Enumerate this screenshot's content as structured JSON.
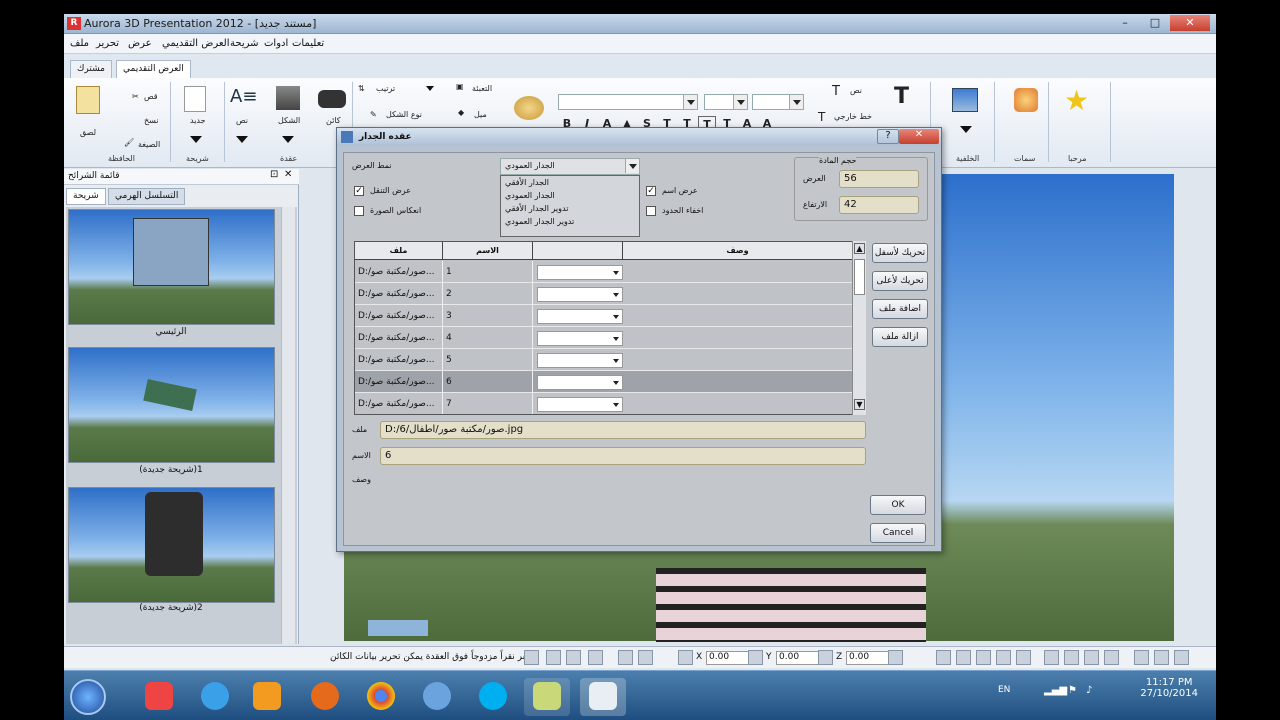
{
  "window": {
    "title": "Aurora 3D Presentation 2012 - [مستند جديد]",
    "min": "–",
    "max": "□",
    "close": "✕"
  },
  "menu": [
    "ملف",
    "تحرير",
    "عرض",
    "العرض التقديمي",
    "شريحة",
    "ادوات",
    "تعليمات"
  ],
  "ribbon_tabs": {
    "share": "مشترك",
    "presentation": "العرض التقديمي"
  },
  "ribbon": {
    "paste": "لصق",
    "cut": "قص",
    "copy": "نسخ",
    "format_painter": "الصيغة",
    "clipboard_group": "الحافظة",
    "new": "جديد",
    "slide_group": "شريحة",
    "text": "نص",
    "shape": "الشكل",
    "object": "كائن",
    "node_group": "عقدة",
    "arrange": "ترتيب",
    "shape_type": "نوع الشكل",
    "fill": "التعبئة",
    "tilt": "ميل",
    "text_btn": "نص",
    "outline_text": "خط خارجي",
    "background": "الخلفية",
    "themes": "سمات",
    "welcome": "مرحبا",
    "format_buttons": [
      "B",
      "I",
      "A",
      "S",
      "T",
      "T",
      "T",
      "T",
      "A",
      "A"
    ]
  },
  "left_panel": {
    "title": "قائمة الشرائح",
    "tab_slide": "شريحة",
    "tab_hierarchy": "التسلسل الهرمي",
    "thumbs": [
      "الرئيسي",
      "(شريحة جديدة)1",
      "(شريحة جديدة)2"
    ]
  },
  "dialog": {
    "title": "عقده الجدار",
    "help": "?",
    "close": "✕",
    "display_mode_label": "نمط العرض",
    "display_mode_value": "الجدار العمودي",
    "dropdown_options": [
      "الجدار الأفقي",
      "الجدار العمودي",
      "تدوير الجدار الأفقي",
      "تدوير الجدار العمودي"
    ],
    "show_transition": "عرض التنقل",
    "reflect_image": "انعكاس الصورة",
    "show_name": "عرض اسم",
    "hide_border": "اخفاء الحدود",
    "material_size": "حجم المادة",
    "width_label": "العرض",
    "width_value": "56",
    "height_label": "الارتفاع",
    "height_value": "42",
    "columns": {
      "file": "ملف",
      "name": "الاسم",
      "desc": "وصف"
    },
    "rows": [
      {
        "file": "D:/صور/مكتبة صو...",
        "name": "1"
      },
      {
        "file": "D:/صور/مكتبة صو...",
        "name": "2"
      },
      {
        "file": "D:/صور/مكتبة صو...",
        "name": "3"
      },
      {
        "file": "D:/صور/مكتبة صو...",
        "name": "4"
      },
      {
        "file": "D:/صور/مكتبة صو...",
        "name": "5"
      },
      {
        "file": "D:/صور/مكتبة صو...",
        "name": "6"
      },
      {
        "file": "D:/صور/مكتبة صو...",
        "name": "7"
      }
    ],
    "move_down": "تحريك لأسفل",
    "move_up": "تحريك لأعلى",
    "add_file": "اضافة ملف",
    "remove_file": "ازالة ملف",
    "file_label": "ملف",
    "file_value": "D:/صور/مكتبة صور/اطفال/6.jpg",
    "name_label": "الاسم",
    "name_value": "6",
    "desc_label": "وصف",
    "ok": "OK",
    "cancel": "Cancel"
  },
  "statusbar": {
    "hint": "انقر نقراً مزدوجاً فوق العقدة يمكن تحرير بيانات الكائن",
    "x_label": "X",
    "x_value": "0.00",
    "y_label": "Y",
    "y_value": "0.00",
    "z_label": "Z",
    "z_value": "0.00"
  },
  "taskbar": {
    "lang": "EN",
    "time": "11:17 PM",
    "date": "27/10/2014"
  }
}
